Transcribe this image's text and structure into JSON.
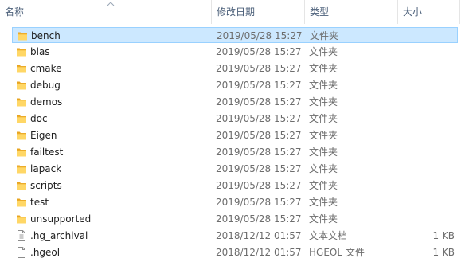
{
  "columns": {
    "name": "名称",
    "date": "修改日期",
    "type": "类型",
    "size": "大小"
  },
  "files": [
    {
      "name": "bench",
      "date": "2019/05/28 15:27",
      "type": "文件夹",
      "size": "",
      "icon": "folder-icon",
      "selected": true
    },
    {
      "name": "blas",
      "date": "2019/05/28 15:27",
      "type": "文件夹",
      "size": "",
      "icon": "folder-icon"
    },
    {
      "name": "cmake",
      "date": "2019/05/28 15:27",
      "type": "文件夹",
      "size": "",
      "icon": "folder-icon"
    },
    {
      "name": "debug",
      "date": "2019/05/28 15:27",
      "type": "文件夹",
      "size": "",
      "icon": "folder-icon"
    },
    {
      "name": "demos",
      "date": "2019/05/28 15:27",
      "type": "文件夹",
      "size": "",
      "icon": "folder-icon"
    },
    {
      "name": "doc",
      "date": "2019/05/28 15:27",
      "type": "文件夹",
      "size": "",
      "icon": "folder-icon"
    },
    {
      "name": "Eigen",
      "date": "2019/05/28 15:27",
      "type": "文件夹",
      "size": "",
      "icon": "folder-icon"
    },
    {
      "name": "failtest",
      "date": "2019/05/28 15:27",
      "type": "文件夹",
      "size": "",
      "icon": "folder-icon"
    },
    {
      "name": "lapack",
      "date": "2019/05/28 15:27",
      "type": "文件夹",
      "size": "",
      "icon": "folder-icon"
    },
    {
      "name": "scripts",
      "date": "2019/05/28 15:27",
      "type": "文件夹",
      "size": "",
      "icon": "folder-icon"
    },
    {
      "name": "test",
      "date": "2019/05/28 15:27",
      "type": "文件夹",
      "size": "",
      "icon": "folder-icon"
    },
    {
      "name": "unsupported",
      "date": "2019/05/28 15:27",
      "type": "文件夹",
      "size": "",
      "icon": "folder-icon"
    },
    {
      "name": ".hg_archival",
      "date": "2018/12/12 01:57",
      "type": "文本文档",
      "size": "1 KB",
      "icon": "text-document-icon"
    },
    {
      "name": ".hgeol",
      "date": "2018/12/12 01:57",
      "type": "HGEOL 文件",
      "size": "1 KB",
      "icon": "file-icon"
    }
  ]
}
